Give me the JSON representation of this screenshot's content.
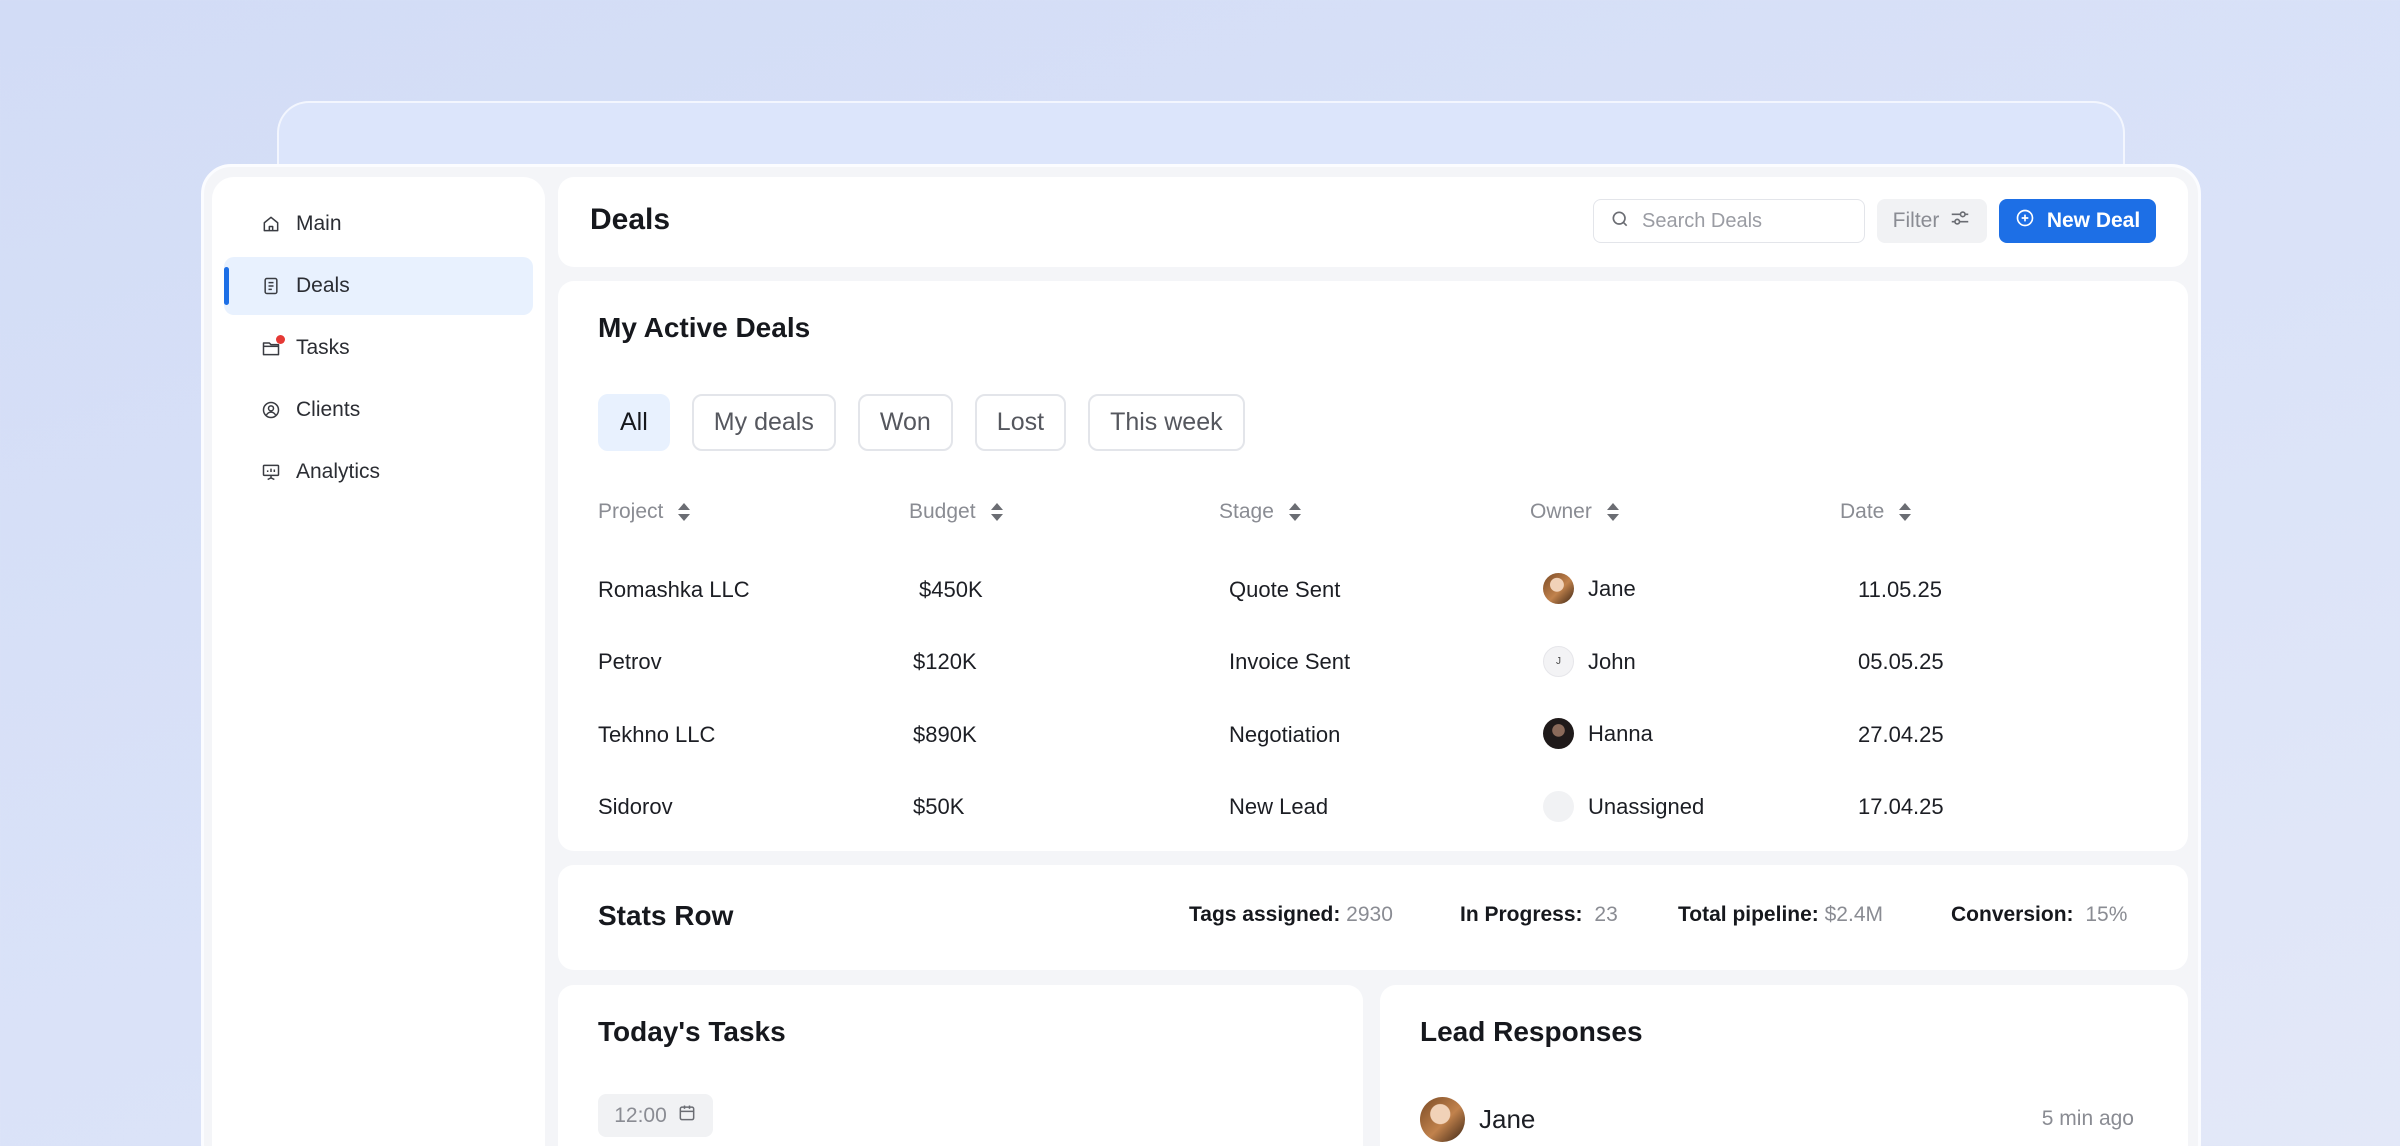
{
  "sidebar": {
    "items": [
      {
        "label": "Main",
        "icon": "home-icon",
        "active": false
      },
      {
        "label": "Deals",
        "icon": "document-icon",
        "active": true
      },
      {
        "label": "Tasks",
        "icon": "folder-icon",
        "active": false,
        "badge": "notification-dot"
      },
      {
        "label": "Clients",
        "icon": "user-circle-icon",
        "active": false
      },
      {
        "label": "Analytics",
        "icon": "presentation-chart-icon",
        "active": false
      }
    ]
  },
  "header": {
    "title": "Deals",
    "search_placeholder": "Search Deals",
    "filter_label": "Filter",
    "new_deal_label": "New Deal"
  },
  "deals": {
    "title": "My Active Deals",
    "tabs": [
      "All",
      "My deals",
      "Won",
      "Lost",
      "This week"
    ],
    "active_tab": "All",
    "columns": [
      "Project",
      "Budget",
      "Stage",
      "Owner",
      "Date"
    ],
    "rows": [
      {
        "project": "Romashka LLC",
        "budget": "$450K",
        "stage": "Quote Sent",
        "owner": "Jane",
        "owner_avatar_text": "",
        "date": "11.05.25"
      },
      {
        "project": "Petrov",
        "budget": "$120K",
        "stage": "Invoice Sent",
        "owner": "John",
        "owner_avatar_text": "J",
        "date": "05.05.25"
      },
      {
        "project": "Tekhno LLC",
        "budget": "$890K",
        "stage": "Negotiation",
        "owner": "Hanna",
        "owner_avatar_text": "",
        "date": "27.04.25"
      },
      {
        "project": "Sidorov",
        "budget": "$50K",
        "stage": "New Lead",
        "owner": "Unassigned",
        "owner_avatar_text": "",
        "date": "17.04.25"
      }
    ]
  },
  "stats": {
    "title": "Stats Row",
    "items": [
      {
        "label": "Tags assigned:",
        "value": "2930"
      },
      {
        "label": "In Progress:",
        "value": "23"
      },
      {
        "label": "Total pipeline:",
        "value": "$2.4M"
      },
      {
        "label": "Conversion:",
        "value": "15%"
      }
    ]
  },
  "tasks": {
    "title": "Today's Tasks",
    "time": "12:00"
  },
  "leads": {
    "title": "Lead Responses",
    "items": [
      {
        "name": "Jane",
        "time": "5 min ago"
      }
    ]
  },
  "colors": {
    "accent": "#1d6fe6",
    "active_bg": "#e8f1fe",
    "notification": "#e53935",
    "muted_text": "#8a8c93"
  }
}
